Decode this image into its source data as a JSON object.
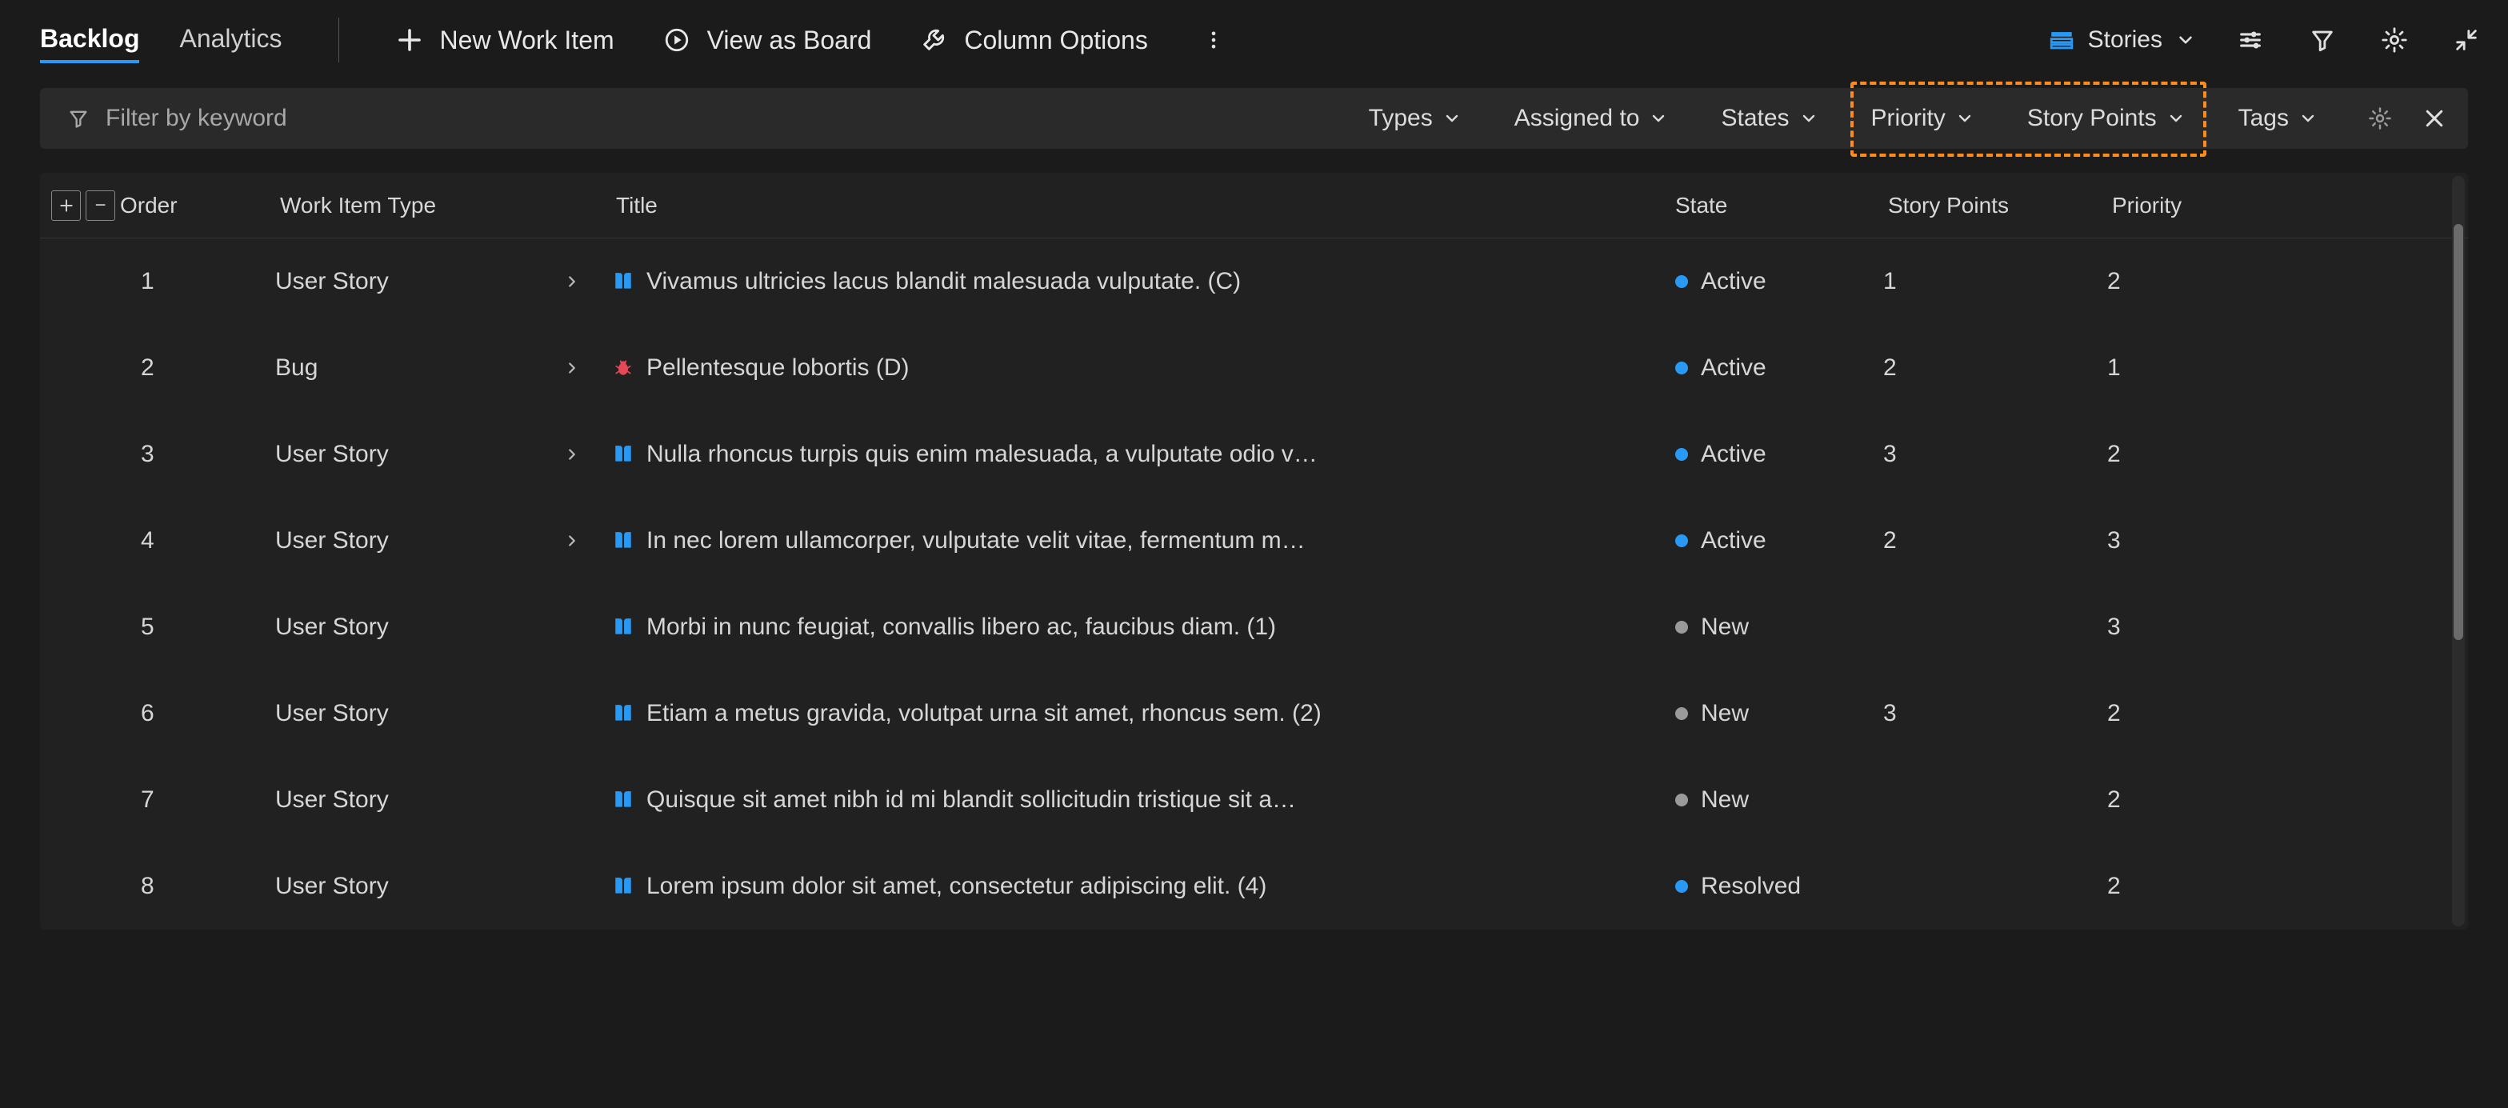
{
  "tabs": {
    "backlog": "Backlog",
    "analytics": "Analytics"
  },
  "toolbar": {
    "new_item": "New Work Item",
    "view_board": "View as Board",
    "column_options": "Column Options",
    "view_selector": "Stories"
  },
  "filter": {
    "placeholder": "Filter by keyword",
    "types": "Types",
    "assigned_to": "Assigned to",
    "states": "States",
    "priority": "Priority",
    "story_points": "Story Points",
    "tags": "Tags"
  },
  "columns": {
    "order": "Order",
    "wit": "Work Item Type",
    "title": "Title",
    "state": "State",
    "sp": "Story Points",
    "priority": "Priority"
  },
  "state_colors": {
    "Active": "blue",
    "New": "grey",
    "Resolved": "blue"
  },
  "rows": [
    {
      "order": "1",
      "type": "User Story",
      "expandable": true,
      "icon": "story",
      "title": "Vivamus ultricies lacus blandit malesuada vulputate. (C)",
      "state": "Active",
      "sp": "1",
      "priority": "2"
    },
    {
      "order": "2",
      "type": "Bug",
      "expandable": true,
      "icon": "bug",
      "title": "Pellentesque lobortis (D)",
      "state": "Active",
      "sp": "2",
      "priority": "1"
    },
    {
      "order": "3",
      "type": "User Story",
      "expandable": true,
      "icon": "story",
      "title": "Nulla rhoncus turpis quis enim malesuada, a vulputate odio v…",
      "state": "Active",
      "sp": "3",
      "priority": "2"
    },
    {
      "order": "4",
      "type": "User Story",
      "expandable": true,
      "icon": "story",
      "title": "In nec lorem ullamcorper, vulputate velit vitae, fermentum m…",
      "state": "Active",
      "sp": "2",
      "priority": "3"
    },
    {
      "order": "5",
      "type": "User Story",
      "expandable": false,
      "icon": "story",
      "title": "Morbi in nunc feugiat, convallis libero ac, faucibus diam. (1)",
      "state": "New",
      "sp": "",
      "priority": "3"
    },
    {
      "order": "6",
      "type": "User Story",
      "expandable": false,
      "icon": "story",
      "title": "Etiam a metus gravida, volutpat urna sit amet, rhoncus sem. (2)",
      "state": "New",
      "sp": "3",
      "priority": "2"
    },
    {
      "order": "7",
      "type": "User Story",
      "expandable": false,
      "icon": "story",
      "title": "Quisque sit amet nibh id mi blandit sollicitudin tristique sit a…",
      "state": "New",
      "sp": "",
      "priority": "2"
    },
    {
      "order": "8",
      "type": "User Story",
      "expandable": false,
      "icon": "story",
      "title": "Lorem ipsum dolor sit amet, consectetur adipiscing elit. (4)",
      "state": "Resolved",
      "sp": "",
      "priority": "2"
    }
  ],
  "colors": {
    "accent": "#2899f5",
    "highlight": "#ff8c1a"
  }
}
